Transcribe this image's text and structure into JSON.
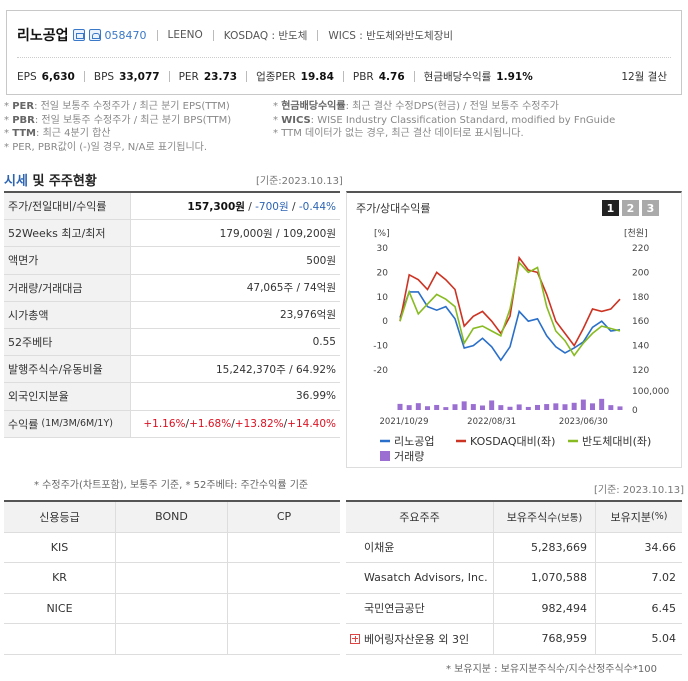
{
  "company": {
    "name": "리노공업",
    "code": "058470",
    "english_name": "LEENO",
    "market": "KOSDAQ : 반도체",
    "wics": "WICS : 반도체와반도체장비",
    "fiscal": "12월 결산",
    "metrics": [
      {
        "label": "EPS",
        "value": "6,630"
      },
      {
        "label": "BPS",
        "value": "33,077"
      },
      {
        "label": "PER",
        "value": "23.73"
      },
      {
        "label": "업종PER",
        "value": "19.84"
      },
      {
        "label": "PBR",
        "value": "4.76"
      },
      {
        "label": "현금배당수익률",
        "value": "1.91%"
      }
    ]
  },
  "notes": {
    "left": [
      {
        "key": "PER",
        "text": ": 전일 보통주 수정주가 / 최근 분기 EPS(TTM)"
      },
      {
        "key": "PBR",
        "text": ": 전일 보통주 수정주가 / 최근 분기 BPS(TTM)"
      },
      {
        "key": "TTM",
        "text": ": 최근 4분기 합산"
      },
      {
        "key": "",
        "text": "PER, PBR값이 (-)일 경우, N/A로 표기됩니다."
      }
    ],
    "right": [
      {
        "key": "현금배당수익률",
        "text": ": 최근 결산 수정DPS(현금) / 전일 보통주 수정주가"
      },
      {
        "key": "WICS",
        "text": ": WISE Industry Classification Standard, modified by FnGuide"
      },
      {
        "key": "",
        "text": "TTM 데이터가 없는 경우, 최근 결산 데이터로 표시됩니다."
      }
    ]
  },
  "section": {
    "title_blue": "시세",
    "title_rest": " 및 주주현황",
    "base_date": "[기준:2023.10.13]"
  },
  "quote_table": [
    {
      "label": "주가/전일대비/수익률",
      "value_main": "157,300원",
      "value_chg": "-700원",
      "value_pct": "-0.44%"
    },
    {
      "label": "52Weeks 최고/최저",
      "value": "179,000원 / 109,200원"
    },
    {
      "label": "액면가",
      "value": "500원"
    },
    {
      "label": "거래량/거래대금",
      "value": "47,065주 / 74억원"
    },
    {
      "label": "시가총액",
      "value": "23,976억원"
    },
    {
      "label": "52주베타",
      "value": "0.55"
    },
    {
      "label": "발행주식수/유동비율",
      "value": "15,242,370주 / 64.92%"
    },
    {
      "label": "외국인지분율",
      "value": "36.99%"
    },
    {
      "label": "수익률",
      "label_sub": "(1M/3M/6M/1Y)",
      "returns": [
        "+1.16%",
        "+1.68%",
        "+13.82%",
        "+14.40%"
      ]
    }
  ],
  "quote_note": "* 수정주가(차트포함), 보통주 기준, * 52주베타: 주간수익률 기준",
  "chart_panel": {
    "title": "주가/상대수익률",
    "pages": [
      "1",
      "2",
      "3"
    ],
    "left_unit": "[%]",
    "right_unit": "[천원]",
    "left_ticks": [
      "30",
      "20",
      "10",
      "0",
      "-10",
      "-20"
    ],
    "right_ticks": [
      "220",
      "200",
      "180",
      "160",
      "140",
      "120"
    ],
    "vol_ticks": [
      "100,000",
      "0"
    ],
    "x_ticks": [
      "2021/10/29",
      "2022/08/31",
      "2023/06/30"
    ],
    "legend": [
      "리노공업",
      "KOSDAQ대비(좌)",
      "반도체대비(좌)",
      "거래량"
    ]
  },
  "chart_data": {
    "type": "line",
    "x": [
      "2021/10/29",
      "2021/11",
      "2021/12",
      "2022/01",
      "2022/02",
      "2022/03",
      "2022/04",
      "2022/05",
      "2022/06",
      "2022/07",
      "2022/08/31",
      "2022/09",
      "2022/10",
      "2022/11",
      "2022/12",
      "2023/01",
      "2023/02",
      "2023/03",
      "2023/04",
      "2023/05",
      "2023/06/30",
      "2023/07",
      "2023/08",
      "2023/09",
      "2023/10"
    ],
    "series": [
      {
        "name": "리노공업",
        "axis": "right",
        "unit": "천원",
        "color": "#2a6fc9",
        "values": [
          163,
          184,
          184,
          172,
          169,
          172,
          162,
          138,
          140,
          146,
          139,
          128,
          139,
          168,
          160,
          162,
          148,
          139,
          134,
          138,
          143,
          155,
          160,
          152,
          153
        ]
      },
      {
        "name": "KOSDAQ대비(좌)",
        "axis": "left",
        "unit": "%",
        "color": "#cc3322",
        "values": [
          0,
          19,
          17,
          13,
          20,
          17,
          13,
          -2,
          2,
          4,
          0,
          -5,
          2,
          26,
          21,
          20,
          11,
          0,
          -5,
          -10,
          -3,
          5,
          4,
          5,
          9
        ]
      },
      {
        "name": "반도체대비(좌)",
        "axis": "left",
        "unit": "%",
        "color": "#88bb22",
        "values": [
          0,
          12,
          3,
          7,
          11,
          9,
          6,
          -9,
          -3,
          -2,
          -4,
          -6,
          5,
          24,
          20,
          22,
          6,
          -4,
          -8,
          -14,
          -9,
          -5,
          -2,
          -3,
          -4
        ]
      },
      {
        "name": "거래량",
        "axis": "volume",
        "unit": "주",
        "color": "#9b6fd1",
        "values": [
          34000,
          27000,
          38000,
          21000,
          28000,
          16000,
          32000,
          48000,
          33000,
          25000,
          53000,
          27000,
          18000,
          31000,
          17000,
          28000,
          33000,
          37000,
          32000,
          40000,
          58000,
          37000,
          62000,
          27000,
          20000
        ]
      }
    ],
    "ylim_left": [
      -20,
      30
    ],
    "ylim_right": [
      120,
      220
    ],
    "ylim_volume": [
      0,
      100000
    ],
    "grid": false,
    "legend_position": "bottom"
  },
  "credit": {
    "base_date": "[기준: 2023.10.13]",
    "headers": [
      "신용등급",
      "BOND",
      "CP"
    ],
    "rows": [
      [
        "KIS",
        "",
        ""
      ],
      [
        "KR",
        "",
        ""
      ],
      [
        "NICE",
        "",
        ""
      ],
      [
        "",
        "",
        ""
      ]
    ]
  },
  "shareholders": {
    "headers": [
      "주요주주",
      "보유주식수",
      "(보통)",
      "보유지분",
      "(%)"
    ],
    "rows": [
      [
        "이채윤",
        "5,283,669",
        "34.66"
      ],
      [
        "Wasatch Advisors, Inc.",
        "1,070,588",
        "7.02"
      ],
      [
        "국민연금공단",
        "982,494",
        "6.45"
      ],
      [
        "베어링자산운용 외 3인",
        "768,959",
        "5.04"
      ]
    ],
    "note": "* 보유지분 : 보유지분주식수/지수산정주식수*100"
  },
  "colors": {
    "accent": "#2c64b4",
    "down": "#2c64b4",
    "up": "#d12"
  }
}
